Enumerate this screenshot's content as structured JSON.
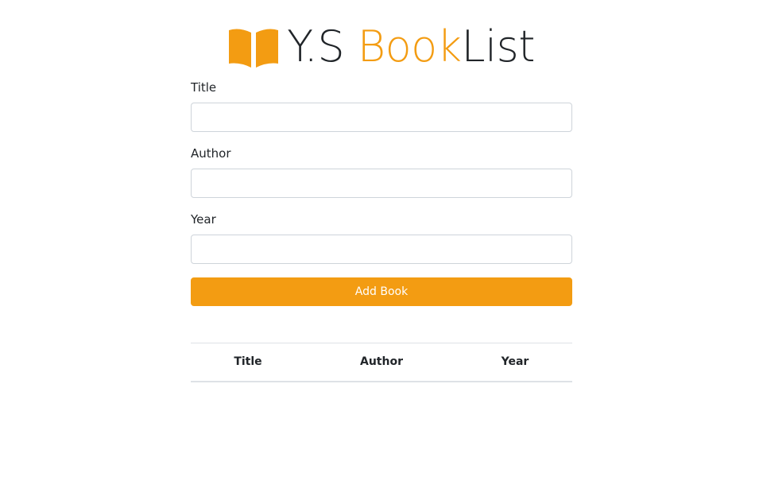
{
  "header": {
    "icon": "book-open-icon",
    "brand_prefix": "Y.S ",
    "brand_accent": "Book",
    "brand_suffix": "List"
  },
  "form": {
    "title_label": "Title",
    "title_value": "",
    "author_label": "Author",
    "author_value": "",
    "year_label": "Year",
    "year_value": "",
    "submit_label": "Add Book"
  },
  "table": {
    "columns": [
      "Title",
      "Author",
      "Year"
    ],
    "rows": []
  },
  "colors": {
    "accent": "#f39c12",
    "text": "#212529",
    "border": "#ced4da"
  }
}
